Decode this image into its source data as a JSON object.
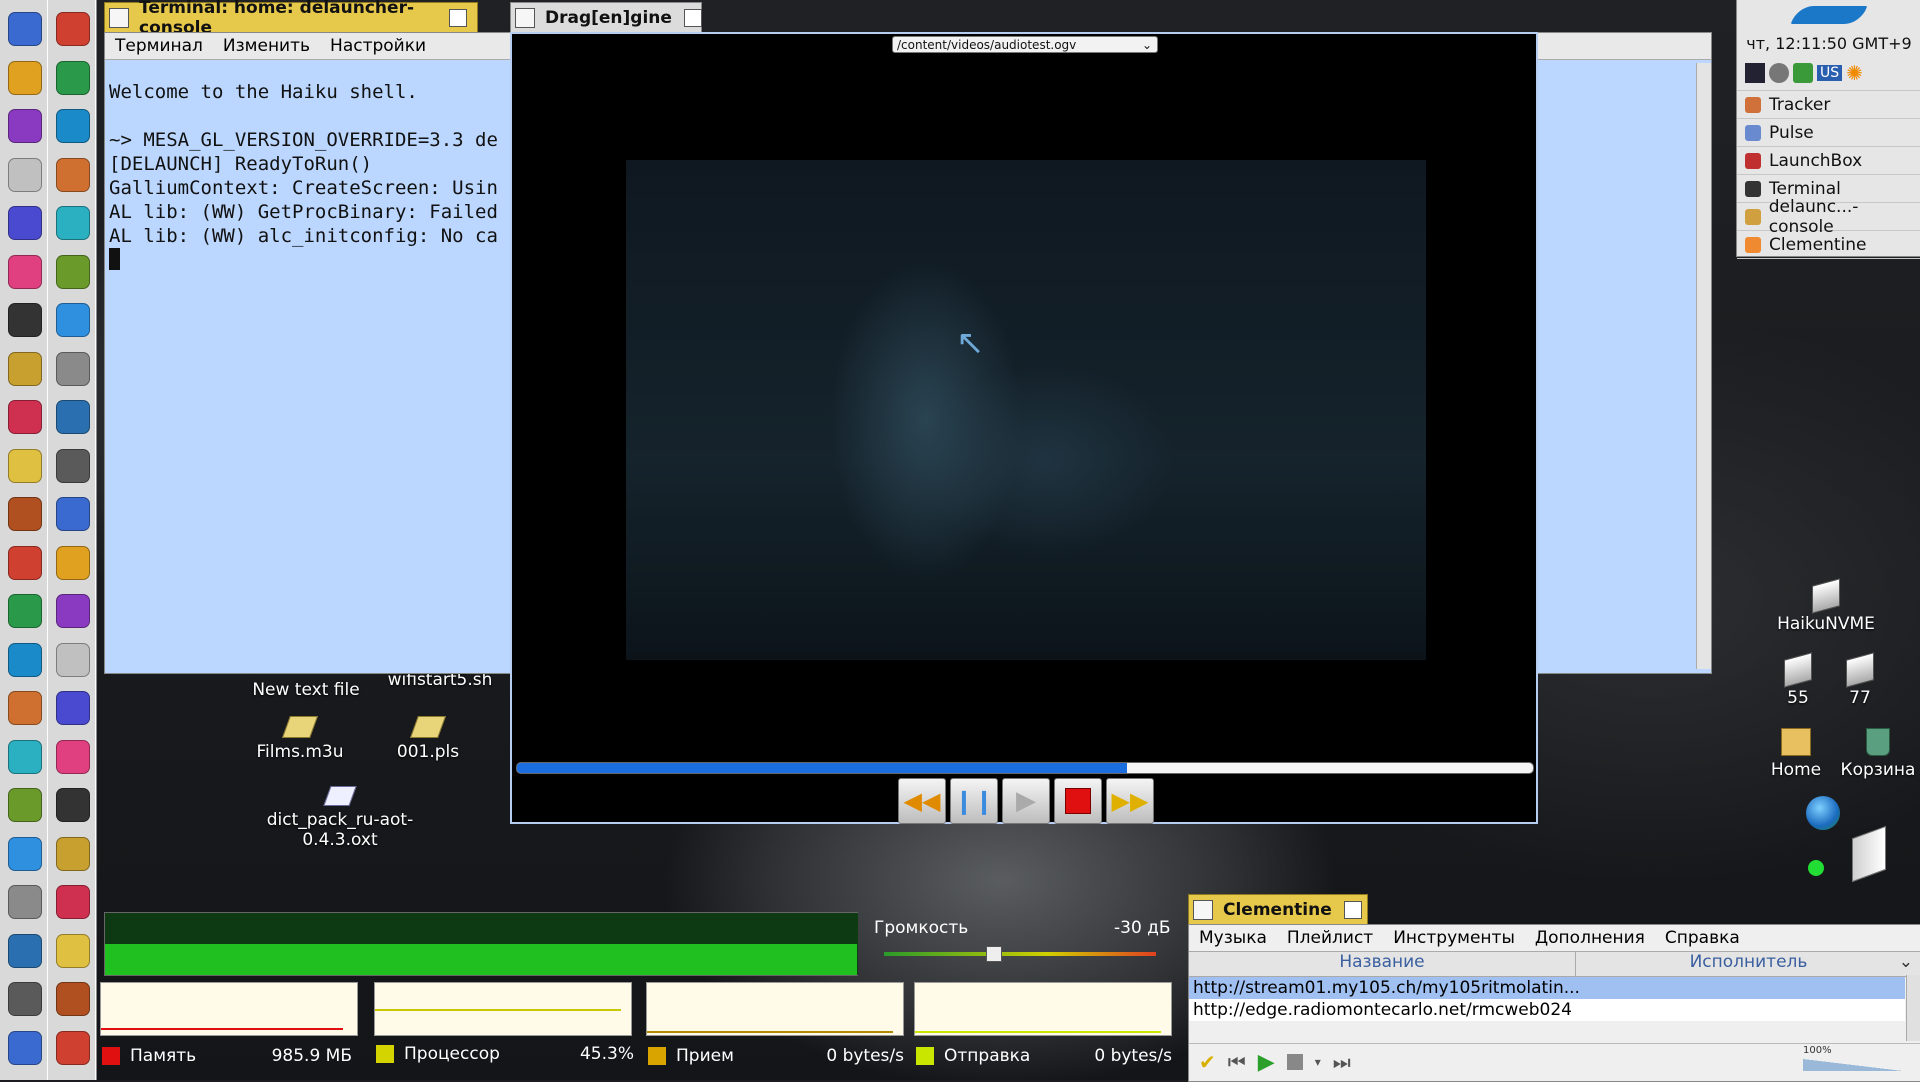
{
  "terminal": {
    "title": "Terminal: home: delauncher-console",
    "menu": [
      "Терминал",
      "Изменить",
      "Настройки"
    ],
    "lines": [
      "Welcome to the Haiku shell.",
      "",
      "~> MESA_GL_VERSION_OVERRIDE=3.3 de",
      "[DELAUNCH] ReadyToRun()",
      "GalliumContext: CreateScreen: Usin",
      "AL lib: (WW) GetProcBinary: Failed",
      "AL lib: (WW) alc_initconfig: No ca"
    ]
  },
  "player": {
    "title": "Drag[en]gine",
    "file_select": "/content/videos/audiotest.ogv",
    "progress": 0.6
  },
  "deskbar": {
    "clock": "чт, 12:11:50 GMT+9",
    "keyboard_layout": "US",
    "apps": [
      "Tracker",
      "Pulse",
      "LaunchBox",
      "Terminal",
      "delaunc...-console",
      "Clementine"
    ]
  },
  "desktop_icons": {
    "new_text_file": "New text file",
    "wifistart": "wifistart5.sh",
    "films": "Films.m3u",
    "pls": "001.pls",
    "dict": "dict_pack_ru-aot-0.4.3.oxt",
    "haikunvme": "HaikuNVME",
    "disk55": "55",
    "disk77": "77",
    "home": "Home",
    "trash": "Корзина"
  },
  "volume": {
    "label": "Громкость",
    "value": "-30 дБ",
    "level": 0.4
  },
  "monitors": {
    "memory": {
      "label": "Память",
      "value": "985.9 МБ",
      "color": "#e01010"
    },
    "cpu": {
      "label": "Процессор",
      "value": "45.3%",
      "color": "#d4d400"
    },
    "rx": {
      "label": "Прием",
      "value": "0 bytes/s",
      "color": "#d9a400"
    },
    "tx": {
      "label": "Отправка",
      "value": "0 bytes/s",
      "color": "#c8e600"
    }
  },
  "clementine": {
    "title": "Clementine",
    "menu": [
      "Музыка",
      "Плейлист",
      "Инструменты",
      "Дополнения",
      "Справка"
    ],
    "col_title": "Название",
    "col_artist": "Исполнитель",
    "rows": [
      "http://stream01.my105.ch/my105ritmolatin...",
      "http://edge.radiomontecarlo.net/rmcweb024"
    ],
    "volume_pct": "100%"
  }
}
